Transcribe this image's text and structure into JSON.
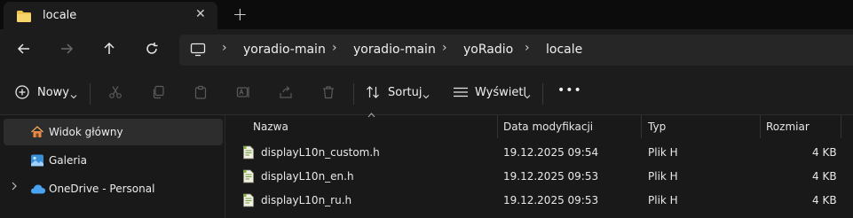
{
  "tab": {
    "title": "locale",
    "close_glyph": "✕",
    "new_tab_glyph": "+"
  },
  "address": {
    "crumbs": [
      "yoradio-main",
      "yoradio-main",
      "yoRadio",
      "locale"
    ],
    "separator": "›"
  },
  "toolbar": {
    "new_label": "Nowy",
    "sort_label": "Sortuj",
    "view_label": "Wyświetl",
    "more_glyph": "•••"
  },
  "sidebar": {
    "items": [
      {
        "label": "Widok główny",
        "icon": "home-icon",
        "selected": true
      },
      {
        "label": "Galeria",
        "icon": "gallery-icon",
        "selected": false
      },
      {
        "label": "OneDrive - Personal",
        "icon": "cloud-icon",
        "selected": false
      }
    ]
  },
  "columns": {
    "name": "Nazwa",
    "modified": "Data modyfikacji",
    "type": "Typ",
    "size": "Rozmiar"
  },
  "files": [
    {
      "name": "displayL10n_custom.h",
      "modified": "19.12.2025 09:54",
      "type": "Plik H",
      "size": "4 KB"
    },
    {
      "name": "displayL10n_en.h",
      "modified": "19.12.2025 09:53",
      "type": "Plik H",
      "size": "4 KB"
    },
    {
      "name": "displayL10n_ru.h",
      "modified": "19.12.2025 09:53",
      "type": "Plik H",
      "size": "4 KB"
    }
  ],
  "colors": {
    "folder": "#f0c24d",
    "accent": "#4aa3f0",
    "background": "#191919"
  }
}
